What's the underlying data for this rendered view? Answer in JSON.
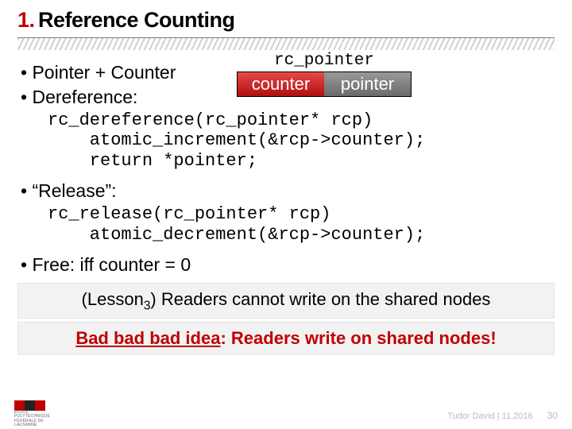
{
  "title": {
    "num": "1.",
    "text": "Reference Counting"
  },
  "bullets": {
    "b1": "Pointer + Counter",
    "b2": "Dereference:",
    "b3": "“Release”:",
    "b4": "Free: iff counter = 0"
  },
  "diagram": {
    "label": "rc_pointer",
    "counter": "counter",
    "pointer": "pointer"
  },
  "code": {
    "deref": "rc_dereference(rc_pointer* rcp)\n    atomic_increment(&rcp->counter);\n    return *pointer;",
    "release": "rc_release(rc_pointer* rcp)\n    atomic_decrement(&rcp->counter);"
  },
  "lesson": {
    "prefix": "(Lesson",
    "num": "3",
    "suffix": ")",
    "text": " Readers cannot write on the shared nodes"
  },
  "bad": {
    "label": "Bad bad bad idea",
    "text": ": Readers write on shared nodes!"
  },
  "footer": {
    "meta": "Tudor David | 11.2016",
    "page": "30"
  },
  "colors": {
    "accent": "#c00000"
  }
}
